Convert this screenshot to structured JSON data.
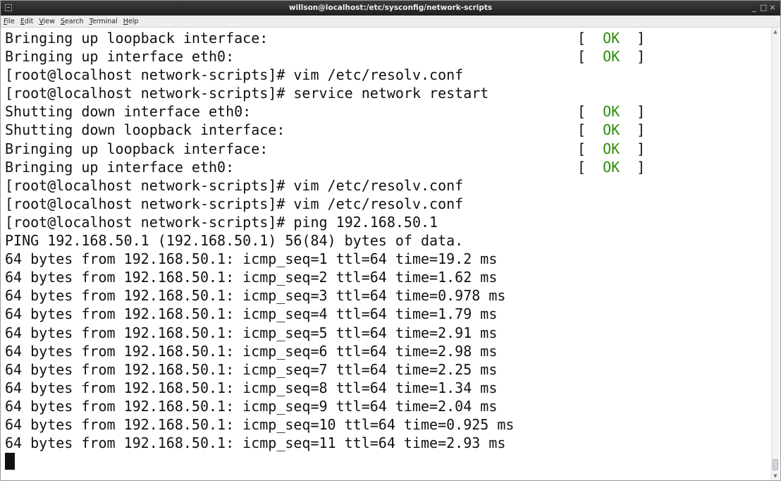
{
  "window": {
    "title": "willson@localhost:/etc/sysconfig/network-scripts",
    "controls": {
      "minimize": "_",
      "maximize": "□",
      "close": "×"
    }
  },
  "menu": [
    "File",
    "Edit",
    "View",
    "Search",
    "Terminal",
    "Help"
  ],
  "terminal": {
    "ok_label": "OK",
    "lines": [
      {
        "text": "Bringing up loopback interface:",
        "status": true
      },
      {
        "text": "Bringing up interface eth0:",
        "status": true
      },
      {
        "text": "[root@localhost network-scripts]# vim /etc/resolv.conf",
        "status": false
      },
      {
        "text": "[root@localhost network-scripts]# service network restart",
        "status": false
      },
      {
        "text": "Shutting down interface eth0:",
        "status": true
      },
      {
        "text": "Shutting down loopback interface:",
        "status": true
      },
      {
        "text": "Bringing up loopback interface:",
        "status": true
      },
      {
        "text": "Bringing up interface eth0:",
        "status": true
      },
      {
        "text": "[root@localhost network-scripts]# vim /etc/resolv.conf",
        "status": false
      },
      {
        "text": "[root@localhost network-scripts]# vim /etc/resolv.conf",
        "status": false
      },
      {
        "text": "[root@localhost network-scripts]# ping 192.168.50.1",
        "status": false
      },
      {
        "text": "PING 192.168.50.1 (192.168.50.1) 56(84) bytes of data.",
        "status": false
      },
      {
        "text": "64 bytes from 192.168.50.1: icmp_seq=1 ttl=64 time=19.2 ms",
        "status": false
      },
      {
        "text": "64 bytes from 192.168.50.1: icmp_seq=2 ttl=64 time=1.62 ms",
        "status": false
      },
      {
        "text": "64 bytes from 192.168.50.1: icmp_seq=3 ttl=64 time=0.978 ms",
        "status": false
      },
      {
        "text": "64 bytes from 192.168.50.1: icmp_seq=4 ttl=64 time=1.79 ms",
        "status": false
      },
      {
        "text": "64 bytes from 192.168.50.1: icmp_seq=5 ttl=64 time=2.91 ms",
        "status": false
      },
      {
        "text": "64 bytes from 192.168.50.1: icmp_seq=6 ttl=64 time=2.98 ms",
        "status": false
      },
      {
        "text": "64 bytes from 192.168.50.1: icmp_seq=7 ttl=64 time=2.25 ms",
        "status": false
      },
      {
        "text": "64 bytes from 192.168.50.1: icmp_seq=8 ttl=64 time=1.34 ms",
        "status": false
      },
      {
        "text": "64 bytes from 192.168.50.1: icmp_seq=9 ttl=64 time=2.04 ms",
        "status": false
      },
      {
        "text": "64 bytes from 192.168.50.1: icmp_seq=10 ttl=64 time=0.925 ms",
        "status": false
      },
      {
        "text": "64 bytes from 192.168.50.1: icmp_seq=11 ttl=64 time=2.93 ms",
        "status": false
      }
    ]
  },
  "colors": {
    "ok": "#2c8d08",
    "titlebar": "#2a2a2a",
    "text": "#111111"
  },
  "icons": {
    "window": "terminal-window-icon",
    "scroll_up": "scroll-up-arrow-icon",
    "scroll_down": "scroll-down-arrow-icon"
  }
}
